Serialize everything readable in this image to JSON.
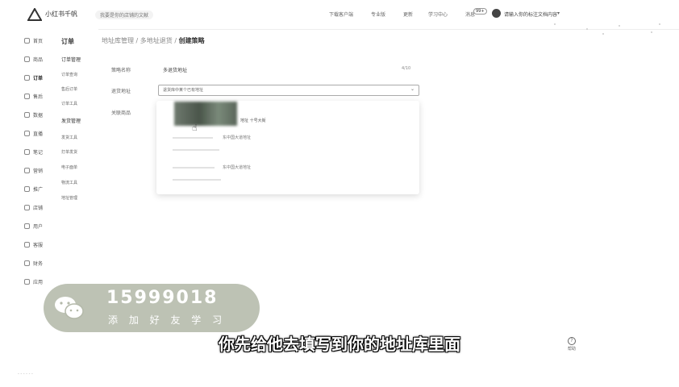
{
  "topbar": {
    "brand": "小红书千帆",
    "shop": "我要是你的店铺的文献",
    "links": [
      "下载客户端",
      "专业版",
      "更新",
      "学习中心",
      "消息"
    ],
    "badge": "99+",
    "username": "请输入你的标注文档内容"
  },
  "sidebar": {
    "items": [
      "首页",
      "商品",
      "订单",
      "售后",
      "数据",
      "直播",
      "笔记",
      "营销",
      "推广",
      "店铺",
      "用户",
      "客服",
      "财务",
      "应用"
    ]
  },
  "subnav": {
    "title": "订单",
    "groups": [
      {
        "label": "订单管理",
        "items": [
          "订单查询",
          "售后订单",
          "订单工具"
        ]
      },
      {
        "label": "发货管理",
        "items": [
          "发货工具",
          "打单发货",
          "电子面单",
          "物流工具",
          "地址管理"
        ]
      }
    ]
  },
  "breadcrumb": {
    "a": "地址库管理",
    "b": "多地址退货",
    "c": "创建策略"
  },
  "form": {
    "name_label": "策略名称",
    "name_value": "多退货地址",
    "name_count": "4/10",
    "address_label": "退货地址",
    "address_value": "退货库中某个已有地址",
    "goods_label": "关联商品"
  },
  "dropdown": {
    "row1": "地址 十号大街",
    "row2": "东中国大道地址",
    "row3": "东中国大道地址"
  },
  "help": {
    "label": "帮助"
  },
  "watermark": {
    "phone": "15999018",
    "sub": "添 加 好 友 学 习"
  },
  "subtitle": "你先给他去填写到你的地址库里面",
  "colors": {
    "watermark_bg": "#b4b9aa",
    "border": "#aaaaaa"
  }
}
